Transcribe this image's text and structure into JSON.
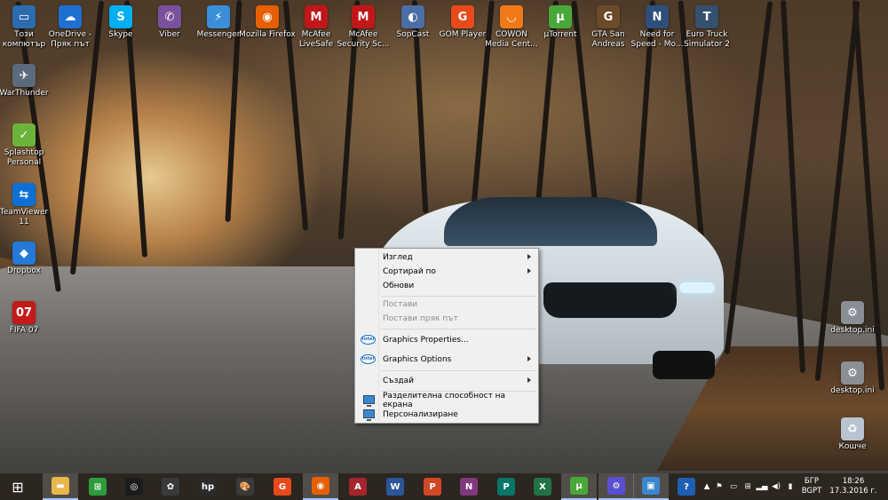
{
  "desktop_icons": [
    {
      "label": "Този компютър",
      "icon": "computer-icon",
      "color": "#2b6cb0",
      "glyph": "▭"
    },
    {
      "label": "OneDrive - Пряк път",
      "icon": "cloud-icon",
      "color": "#1e6fd0",
      "glyph": "☁"
    },
    {
      "label": "Skype",
      "icon": "skype-icon",
      "color": "#00aff0",
      "glyph": "S"
    },
    {
      "label": "Viber",
      "icon": "viber-icon",
      "color": "#7b519d",
      "glyph": "✆"
    },
    {
      "label": "Messenger",
      "icon": "messenger-icon",
      "color": "#3b8ed8",
      "glyph": "⚡"
    },
    {
      "label": "Mozilla Firefox",
      "icon": "firefox-icon",
      "color": "#e66000",
      "glyph": "◉"
    },
    {
      "label": "McAfee LiveSafe",
      "icon": "mcafee-icon",
      "color": "#c01818",
      "glyph": "M"
    },
    {
      "label": "McAfee Security Sc...",
      "icon": "mcafee-scan-icon",
      "color": "#c01818",
      "glyph": "M"
    },
    {
      "label": "SopCast",
      "icon": "sopcast-icon",
      "color": "#4a6fa5",
      "glyph": "◐"
    },
    {
      "label": "GOM Player",
      "icon": "gom-icon",
      "color": "#e84a1c",
      "glyph": "G"
    },
    {
      "label": "COWON Media Cent...",
      "icon": "cowon-icon",
      "color": "#f07a1a",
      "glyph": "◡"
    },
    {
      "label": "µTorrent",
      "icon": "utorrent-icon",
      "color": "#4aa83a",
      "glyph": "µ"
    },
    {
      "label": "GTA San Andreas",
      "icon": "gta-icon",
      "color": "#6b4a2a",
      "glyph": "G"
    },
    {
      "label": "Need for Speed - Mo...",
      "icon": "nfs-icon",
      "color": "#2d4f7a",
      "glyph": "N"
    },
    {
      "label": "Euro Truck Simulator 2",
      "icon": "truck-icon",
      "color": "#35506e",
      "glyph": "T"
    },
    {
      "label": "WarThunder",
      "icon": "warthunder-icon",
      "color": "#5b6b7d",
      "glyph": "✈"
    },
    {
      "label": "Splashtop Personal",
      "icon": "splashtop-icon",
      "color": "#6bb33b",
      "glyph": "✓"
    },
    {
      "label": "TeamViewer 11",
      "icon": "teamviewer-icon",
      "color": "#0e6fd6",
      "glyph": "⇆"
    },
    {
      "label": "Dropbox",
      "icon": "dropbox-icon",
      "color": "#2478d8",
      "glyph": "◆"
    },
    {
      "label": "FIFA 07",
      "icon": "fifa-icon",
      "color": "#c41a1a",
      "glyph": "07"
    },
    {
      "label": "desktop.ini",
      "icon": "settings-file-icon",
      "color": "#8a8f96",
      "glyph": "⚙"
    },
    {
      "label": "desktop.ini",
      "icon": "settings-file-icon",
      "color": "#8a8f96",
      "glyph": "⚙"
    },
    {
      "label": "Кошче",
      "icon": "recycle-bin-icon",
      "color": "#b8c4cf",
      "glyph": "♻"
    }
  ],
  "context_menu": {
    "view": "Изглед",
    "sort_by": "Сортирай по",
    "refresh": "Обнови",
    "paste": "Постави",
    "paste_shortcut": "Постави пряк път",
    "graphics_properties": "Graphics Properties...",
    "graphics_options": "Graphics Options",
    "new": "Създай",
    "screen_resolution": "Разделителна способност на екрана",
    "personalize": "Персонализиране",
    "intel_badge": "intel"
  },
  "taskbar": {
    "apps": [
      {
        "name": "start-button",
        "icon": "windows-logo-icon",
        "color": "",
        "glyph": "⊞"
      },
      {
        "name": "file-explorer",
        "icon": "folder-icon",
        "color": "#e8b84a",
        "glyph": "▬"
      },
      {
        "name": "store",
        "icon": "store-icon",
        "color": "#2e9c3a",
        "glyph": "⊞"
      },
      {
        "name": "camera",
        "icon": "camera-icon",
        "color": "#1c1c1c",
        "glyph": "◎"
      },
      {
        "name": "photos-app",
        "icon": "photos-icon",
        "color": "#3a3a3a",
        "glyph": "✿"
      },
      {
        "name": "hp",
        "icon": "hp-icon",
        "color": "#2a2a2a",
        "glyph": "hp"
      },
      {
        "name": "paint",
        "icon": "paint-icon",
        "color": "#3a3a3a",
        "glyph": "🎨"
      },
      {
        "name": "gom-player",
        "icon": "gom-icon",
        "color": "#e84a1c",
        "glyph": "G"
      },
      {
        "name": "firefox",
        "icon": "firefox-icon",
        "color": "#e66000",
        "glyph": "◉"
      },
      {
        "name": "access",
        "icon": "access-icon",
        "color": "#a4262c",
        "glyph": "A"
      },
      {
        "name": "word",
        "icon": "word-icon",
        "color": "#2b579a",
        "glyph": "W"
      },
      {
        "name": "powerpoint",
        "icon": "powerpoint-icon",
        "color": "#d24726",
        "glyph": "P"
      },
      {
        "name": "onenote",
        "icon": "onenote-icon",
        "color": "#80397b",
        "glyph": "N"
      },
      {
        "name": "publisher",
        "icon": "publisher-icon",
        "color": "#077568",
        "glyph": "P"
      },
      {
        "name": "excel",
        "icon": "excel-icon",
        "color": "#217346",
        "glyph": "X"
      },
      {
        "name": "utorrent",
        "icon": "utorrent-icon",
        "color": "#4aa83a",
        "glyph": "µ"
      },
      {
        "name": "settings",
        "icon": "gear-icon",
        "color": "#5a4fcf",
        "glyph": "⚙"
      },
      {
        "name": "remote-desktop",
        "icon": "monitor-icon",
        "color": "#3b87cf",
        "glyph": "▣"
      },
      {
        "name": "help",
        "icon": "help-icon",
        "color": "#1e5fb4",
        "glyph": "?"
      }
    ],
    "tray": {
      "language_top": "БГР",
      "language_bottom": "BGPT",
      "time": "18:26",
      "date": "17.3.2016 г."
    }
  }
}
